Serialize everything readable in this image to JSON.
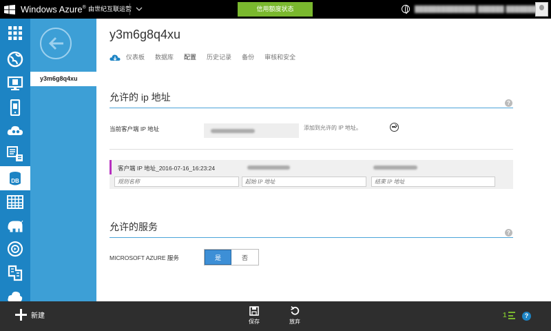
{
  "topbar": {
    "brand": "Windows Azure",
    "brand_sup": "®",
    "subscription": "由世纪互联运营",
    "credit_status": "信用额度状态"
  },
  "left_nav": {
    "icons": [
      "all-items-icon",
      "web-sites-icon",
      "virtual-machines-icon",
      "mobile-services-icon",
      "cloud-services-icon",
      "batch-icon",
      "sql-databases-icon",
      "storage-icon",
      "hdinsight-icon",
      "media-services-icon",
      "service-bus-icon",
      "mobile-cloud-icon"
    ],
    "active_label": "DB"
  },
  "sub_nav": {
    "item": "y3m6g8q4xu"
  },
  "page": {
    "title": "y3m6g8q4xu",
    "tabs": [
      "仪表板",
      "数据库",
      "配置",
      "历史记录",
      "备份",
      "审核和安全"
    ],
    "selected_tab": "配置"
  },
  "allowed_ip": {
    "title": "允许的 ip 地址",
    "help": "?",
    "current_ip_label": "当前客户端 IP 地址",
    "add_label": "添加到允许的 IP 地址。",
    "rule": {
      "name": "客户端 IP 地址_2016-07-16_16:23:24"
    },
    "placeholders": {
      "rule_name": "规则名称",
      "start_ip": "起始 IP 地址",
      "end_ip": "结束 IP 地址"
    }
  },
  "allowed_services": {
    "title": "允许的服务",
    "help": "?",
    "azure_label": "MICROSOFT AZURE 服务",
    "yes": "是",
    "no": "否",
    "selected": "是"
  },
  "bottombar": {
    "new_label": "新建",
    "save_label": "保存",
    "discard_label": "放弃",
    "status_count": "1",
    "help": "?"
  },
  "colors": {
    "nav_blue": "#1d84c4",
    "subnav_blue": "#3d9fd6",
    "credit_green": "#7ab82e",
    "rule_accent": "#b62fbf"
  }
}
